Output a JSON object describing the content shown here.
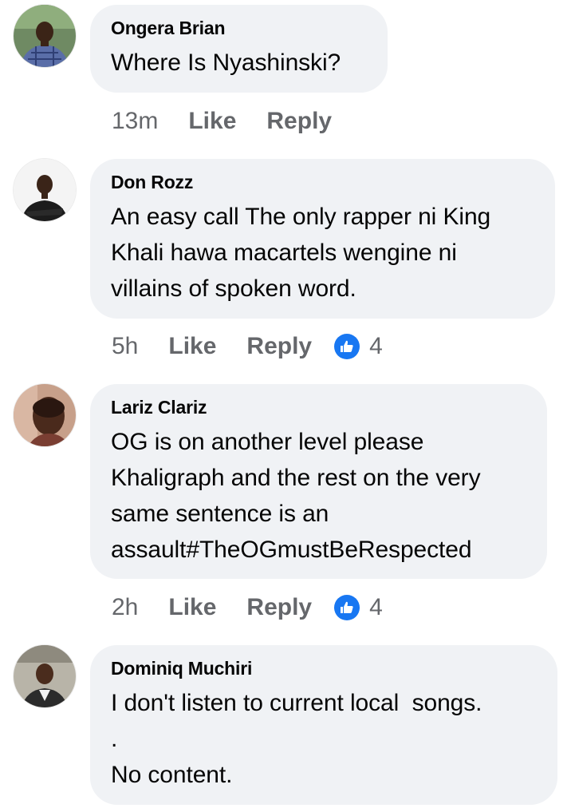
{
  "colors": {
    "bubble_bg": "#f0f2f5",
    "meta_text": "#65676b",
    "author_text": "#050505",
    "like_badge": "#1877f2"
  },
  "comments": [
    {
      "author": "Ongera Brian",
      "lines": [
        "Where Is Nyashinski?"
      ],
      "time": "13m",
      "like_label": "Like",
      "reply_label": "Reply",
      "reaction_count": null,
      "avatar_icon": "avatar-photo-icon"
    },
    {
      "author": "Don Rozz",
      "lines": [
        "An easy call The only rapper ni King",
        "Khali hawa macartels wengine ni",
        "villains of spoken word."
      ],
      "time": "5h",
      "like_label": "Like",
      "reply_label": "Reply",
      "reaction_count": "4",
      "avatar_icon": "avatar-photo-icon"
    },
    {
      "author": "Lariz Clariz",
      "lines": [
        "OG is on another level please",
        "Khaligraph and the rest on the very",
        "same sentence is an",
        "assault#TheOGmustBeRespected"
      ],
      "time": "2h",
      "like_label": "Like",
      "reply_label": "Reply",
      "reaction_count": "4",
      "avatar_icon": "avatar-photo-icon"
    },
    {
      "author": "Dominiq Muchiri",
      "lines": [
        "I don't listen to current local  songs.",
        ".",
        "No content."
      ],
      "avatar_icon": "avatar-photo-icon"
    }
  ]
}
